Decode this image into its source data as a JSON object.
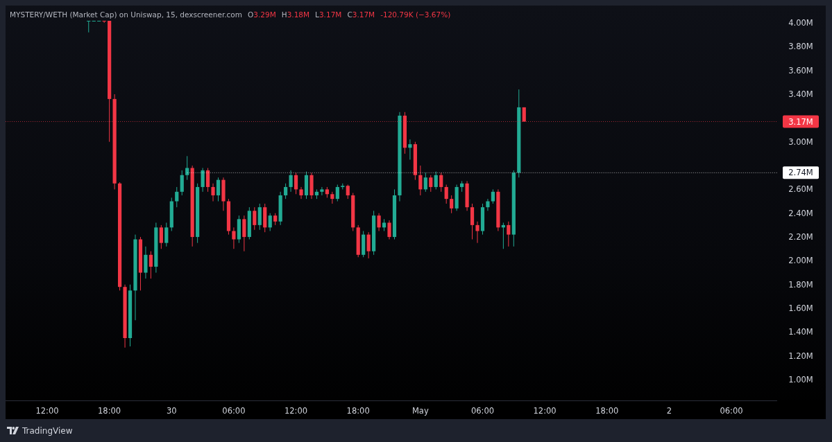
{
  "chart": {
    "legend": {
      "title": "MYSTERY/WETH (Market Cap) on Uniswap, 15, dexscreener.com",
      "ohlc": [
        {
          "key": "O",
          "value": "3.29M"
        },
        {
          "key": "H",
          "value": "3.18M"
        },
        {
          "key": "L",
          "value": "3.17M"
        },
        {
          "key": "C",
          "value": "3.17M"
        }
      ],
      "change": "-120.79K (−3.67%)"
    },
    "price_axis": [
      "4.00M",
      "3.80M",
      "3.60M",
      "3.40M",
      "3.00M",
      "2.60M",
      "2.40M",
      "2.20M",
      "2.00M",
      "1.80M",
      "1.60M",
      "1.40M",
      "1.20M",
      "1.00M"
    ],
    "price_tags": [
      {
        "label": "3.17M",
        "color": "#f23645"
      },
      {
        "label": "2.74M",
        "color": "#ffffff"
      }
    ],
    "time_axis": [
      "12:00",
      "18:00",
      "30",
      "06:00",
      "12:00",
      "18:00",
      "May",
      "06:00",
      "12:00",
      "18:00",
      "2",
      "06:00"
    ]
  },
  "footer": {
    "brand": "TradingView"
  }
}
